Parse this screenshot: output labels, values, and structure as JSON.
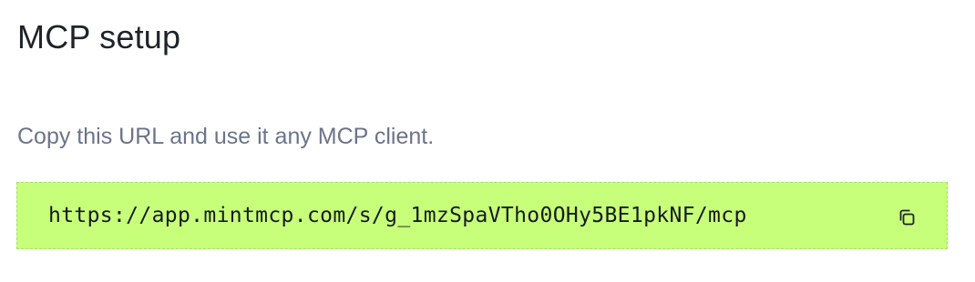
{
  "heading": "MCP setup",
  "description": "Copy this URL and use it any MCP client.",
  "url_box": {
    "url": "https://app.mintmcp.com/s/g_1mzSpaVTho0OHy5BE1pkNF/mcp",
    "copy_icon": "copy-icon"
  },
  "colors": {
    "url_box_background": "#c8ff7a",
    "description_text": "#6b7489",
    "heading_text": "#1f2328"
  }
}
